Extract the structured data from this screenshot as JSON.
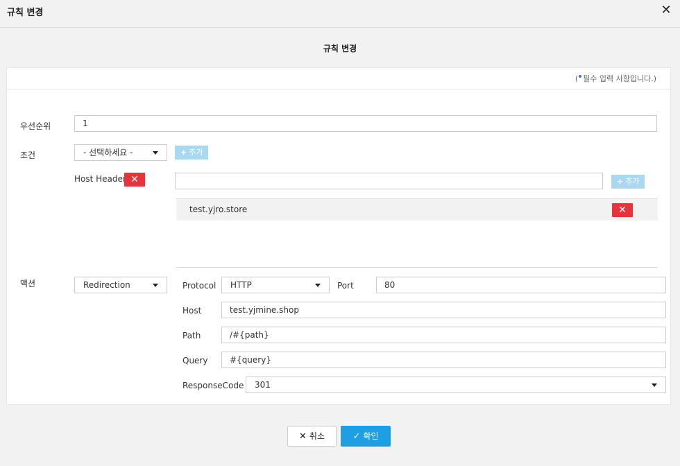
{
  "window": {
    "title": "규칙 변경",
    "close_icon": "close-icon"
  },
  "dialog": {
    "heading": "규칙 변경",
    "required_note_open": "(",
    "required_note_text": "필수 입력 사항입니다.)"
  },
  "form": {
    "priority": {
      "label": "우선순위",
      "value": "1"
    },
    "condition": {
      "label": "조건",
      "select_value": "- 선택하세요 -",
      "add_label": "추가",
      "host_header": {
        "label": "Host Header",
        "input_value": "",
        "add_label": "추가",
        "values": [
          "test.yjro.store"
        ]
      }
    },
    "action": {
      "label": "액션",
      "select_value": "Redirection",
      "protocol": {
        "label": "Protocol",
        "value": "HTTP"
      },
      "port": {
        "label": "Port",
        "value": "80"
      },
      "host": {
        "label": "Host",
        "value": "test.yjmine.shop"
      },
      "path": {
        "label": "Path",
        "value": "/#{path}"
      },
      "query": {
        "label": "Query",
        "value": "#{query}"
      },
      "response_code": {
        "label": "ResponseCode",
        "value": "301"
      }
    }
  },
  "footer": {
    "cancel_label": "취소",
    "ok_label": "확인"
  },
  "colors": {
    "primary": "#1e9ee3",
    "danger": "#e8333c",
    "add_disabled": "#a9d8f2",
    "required_dot": "#2a7ad6"
  }
}
